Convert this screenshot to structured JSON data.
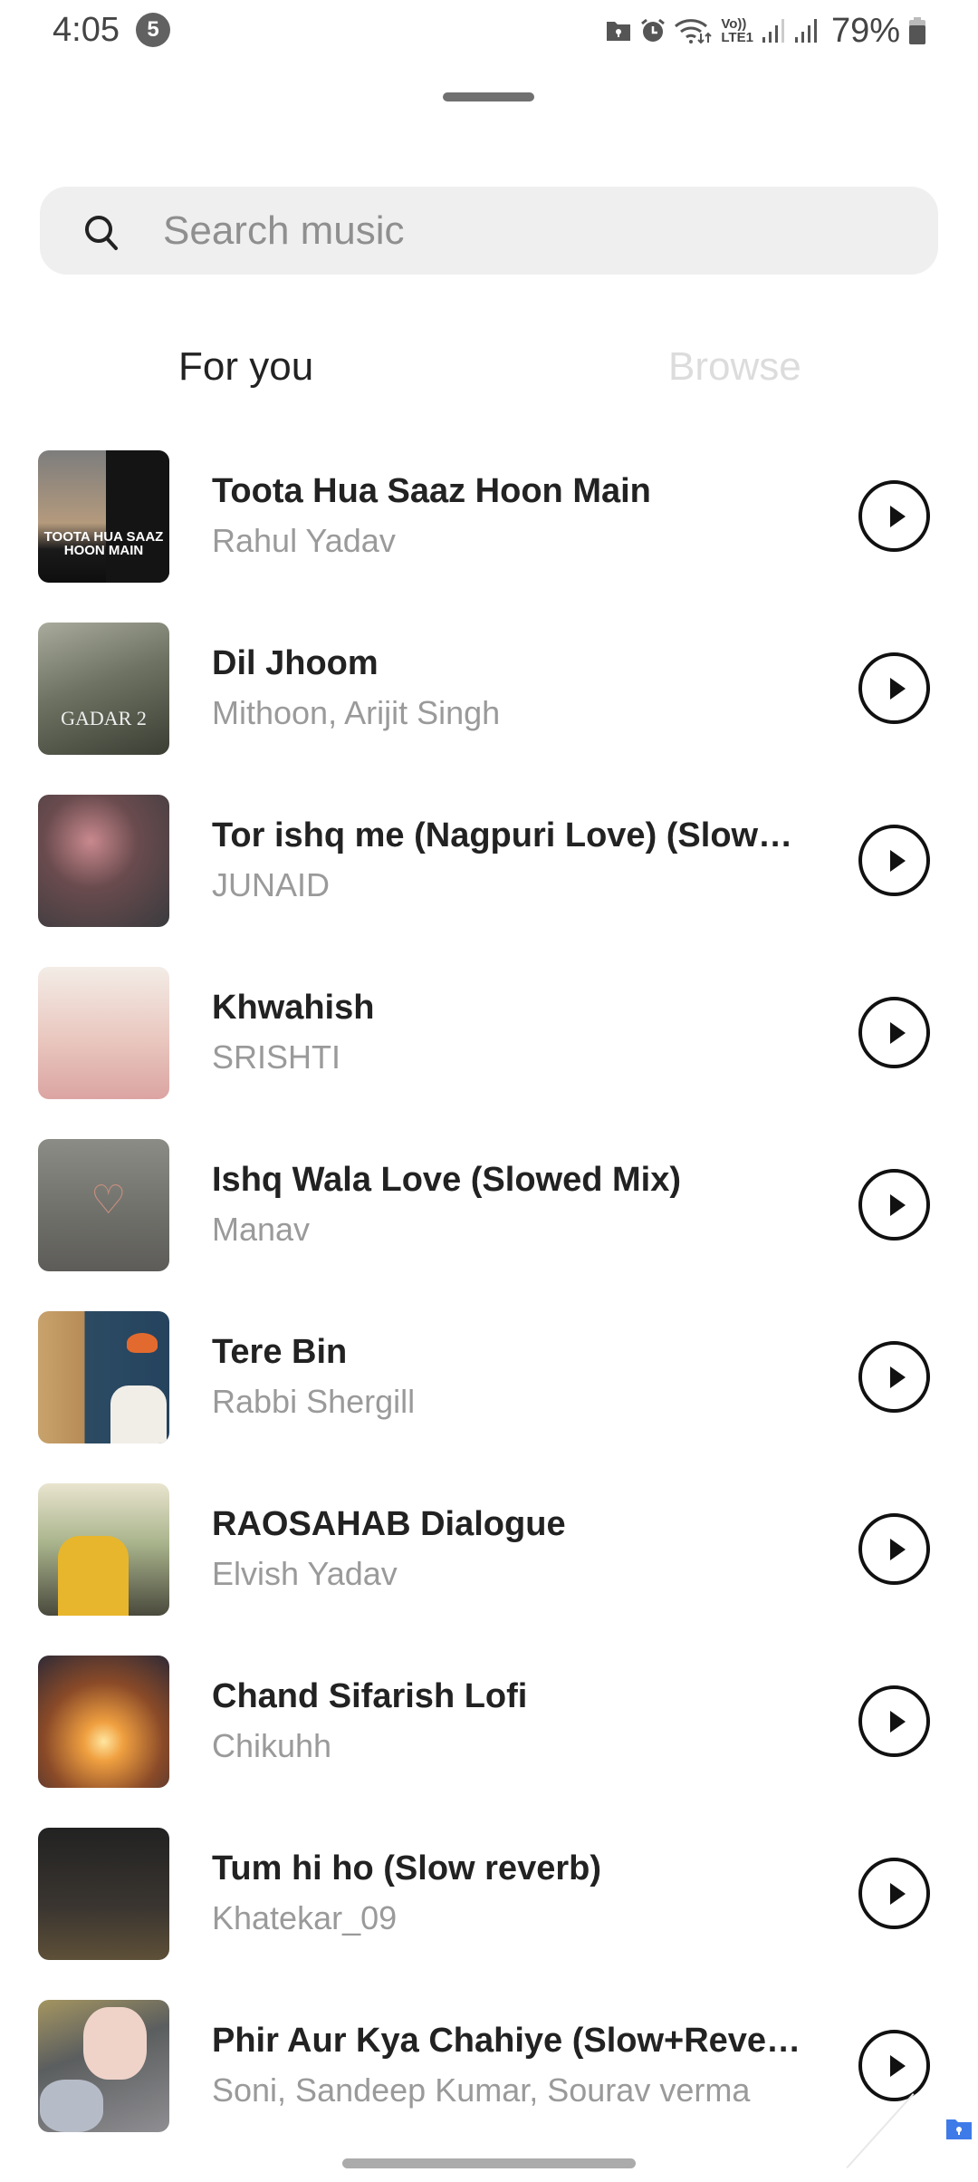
{
  "status_bar": {
    "time": "4:05",
    "notification_count": "5",
    "icons": [
      "secure-folder-icon",
      "alarm-icon",
      "wifi-icon",
      "volte-lte1-icon",
      "signal-sim1-icon",
      "signal-sim2-icon",
      "battery-icon"
    ],
    "volte_top": "Vo))",
    "volte_bottom": "LTE1",
    "battery_percent": "79%"
  },
  "search": {
    "placeholder": "Search music",
    "value": ""
  },
  "tabs": [
    {
      "label": "For you",
      "active": true
    },
    {
      "label": "Browse",
      "active": false
    }
  ],
  "songs": [
    {
      "title": "Toota Hua Saaz Hoon Main",
      "artist": "Rahul Yadav",
      "art_text": "TOOTA HUA SAAZ HOON MAIN"
    },
    {
      "title": "Dil Jhoom",
      "artist": "Mithoon, Arijit Singh",
      "art_text": "GADAR 2"
    },
    {
      "title": "Tor ishq me (Nagpuri Love) (Slowed + Reverb)",
      "artist": "JUNAID"
    },
    {
      "title": "Khwahish",
      "artist": "SRISHTI"
    },
    {
      "title": "Ishq Wala Love (Slowed Mix)",
      "artist": "Manav"
    },
    {
      "title": "Tere Bin",
      "artist": "Rabbi Shergill"
    },
    {
      "title": "RAOSAHAB Dialogue",
      "artist": "Elvish Yadav"
    },
    {
      "title": "Chand Sifarish Lofi",
      "artist": "Chikuhh"
    },
    {
      "title": "Tum hi ho (Slow reverb)",
      "artist": "Khatekar_09"
    },
    {
      "title": "Phir Aur Kya Chahiye (Slow+Reverb)",
      "artist": "Soni, Sandeep Kumar, Sourav verma"
    }
  ],
  "colors": {
    "accent_secure_folder": "#3f7be8",
    "title_text": "#222222",
    "subtitle_text": "#9a9a9a",
    "inactive_tab": "#dcdcdc",
    "search_bg": "#efefef"
  }
}
